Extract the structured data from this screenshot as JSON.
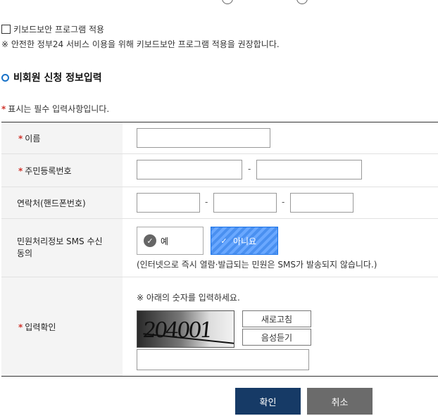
{
  "keyboard_security": {
    "checkbox_label": "키보드보안 프로그램 적용",
    "notice": "※ 안전한 정부24 서비스 이용을 위해 키보드보안 프로그램 적용을 권장합니다."
  },
  "section": {
    "title": "비회원 신청 정보입력"
  },
  "required_note": {
    "star": "*",
    "text": "표시는 필수 입력사항입니다."
  },
  "form": {
    "name": {
      "label": "이름",
      "required": true,
      "value": ""
    },
    "resident_number": {
      "label": "주민등록번호",
      "required": true,
      "part1": "",
      "part2": "",
      "separator": "-"
    },
    "phone": {
      "label": "연락처(핸드폰번호)",
      "required": false,
      "part1": "",
      "part2": "",
      "part3": "",
      "separator": "-"
    },
    "sms": {
      "label_line1": "민원처리정보 SMS 수신",
      "label_line2": "동의",
      "yes_label": "예",
      "no_label": "아니요",
      "selected": "아니요",
      "note": "(인터넷으로 즉시 열람·발급되는 민원은 SMS가 발송되지 않습니다.)"
    },
    "captcha": {
      "label": "입력확인",
      "required": true,
      "instruction": "※ 아래의 숫자를 입력하세요.",
      "image_text": "204001",
      "refresh_label": "새로고침",
      "audio_label": "음성듣기",
      "value": ""
    }
  },
  "actions": {
    "confirm_label": "확인",
    "cancel_label": "취소"
  },
  "colors": {
    "accent": "#1a73c8",
    "confirm": "#163a66",
    "cancel": "#6b6b6b",
    "selected_toggle": "#4a90f0",
    "required_star": "#d0342c"
  },
  "icons": {
    "checkmark": "check-icon",
    "section_marker": "ring-icon"
  }
}
